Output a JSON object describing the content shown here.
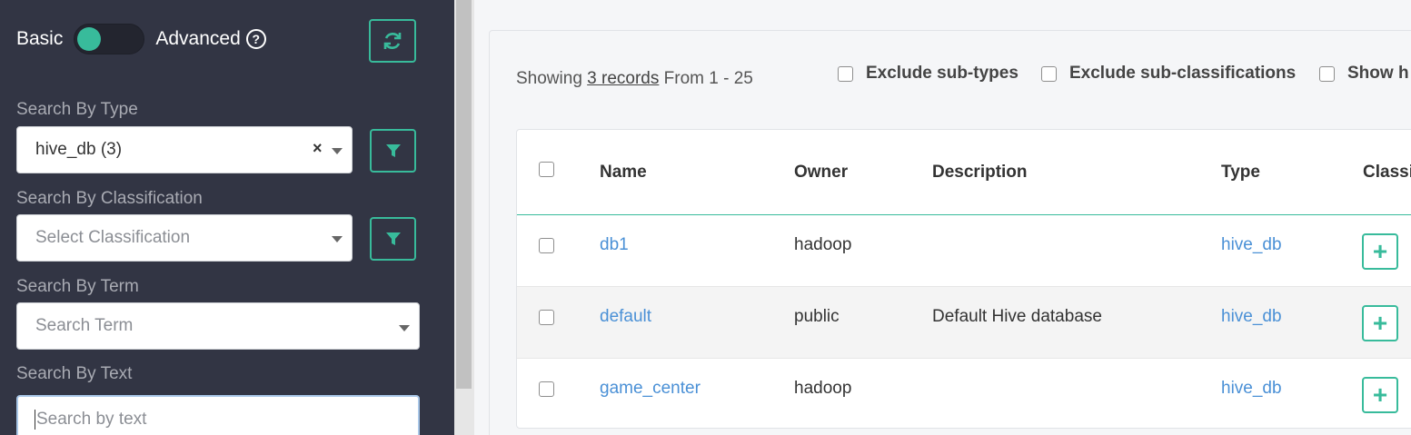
{
  "sidebar": {
    "mode_basic": "Basic",
    "mode_advanced": "Advanced",
    "help_glyph": "?",
    "refresh_icon": "refresh-icon",
    "search_by_type": {
      "label": "Search By Type",
      "value": "hive_db (3)",
      "clear": "×"
    },
    "search_by_classification": {
      "label": "Search By Classification",
      "placeholder": "Select Classification"
    },
    "search_by_term": {
      "label": "Search By Term",
      "placeholder": "Search Term"
    },
    "search_by_text": {
      "label": "Search By Text",
      "placeholder": "Search by text"
    }
  },
  "results": {
    "showing_prefix": "Showing ",
    "showing_link": "3 records",
    "showing_suffix": " From 1 - 25",
    "options": [
      "Exclude sub-types",
      "Exclude sub-classifications",
      "Show h"
    ],
    "columns": [
      "Name",
      "Owner",
      "Description",
      "Type",
      "Classi"
    ],
    "rows": [
      {
        "name": "db1",
        "owner": "hadoop",
        "description": "",
        "type": "hive_db"
      },
      {
        "name": "default",
        "owner": "public",
        "description": "Default Hive database",
        "type": "hive_db"
      },
      {
        "name": "game_center",
        "owner": "hadoop",
        "description": "",
        "type": "hive_db"
      }
    ],
    "add_glyph": "+"
  },
  "colors": {
    "sidebar_bg": "#323544",
    "accent": "#38bb9b",
    "link": "#4a90d6"
  }
}
